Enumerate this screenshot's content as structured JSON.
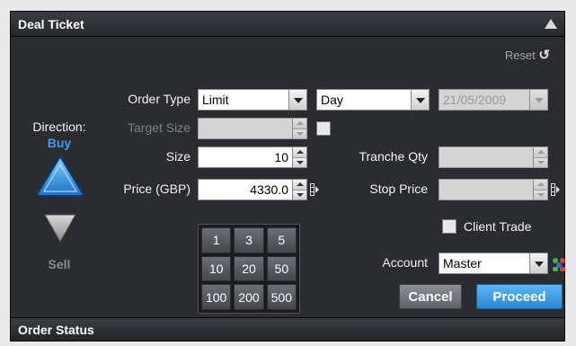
{
  "panel": {
    "title": "Deal Ticket",
    "status_title": "Order Status"
  },
  "reset": {
    "label": "Reset",
    "icon": "refresh-icon"
  },
  "direction": {
    "label": "Direction:",
    "value": "Buy",
    "buy_label": "Buy",
    "sell_label": "Sell"
  },
  "order_type": {
    "label": "Order Type",
    "value": "Limit",
    "duration": "Day",
    "date": "21/05/2009"
  },
  "target_size": {
    "label": "Target Size",
    "value": ""
  },
  "size": {
    "label": "Size",
    "value": "10"
  },
  "price": {
    "label": "Price (GBP)",
    "value": "4330.0"
  },
  "tranche_qty": {
    "label": "Tranche Qty",
    "value": ""
  },
  "stop_price": {
    "label": "Stop Price",
    "value": ""
  },
  "client_trade": {
    "label": "Client Trade",
    "checked": false
  },
  "account": {
    "label": "Account",
    "value": "Master"
  },
  "keypad": {
    "keys": [
      "1",
      "3",
      "5",
      "10",
      "20",
      "50",
      "100",
      "200",
      "500"
    ]
  },
  "buttons": {
    "cancel": "Cancel",
    "proceed": "Proceed"
  },
  "colors": {
    "accent": "#3e9bf0",
    "proceed": "#2a86d4",
    "background": "#2a2c30"
  }
}
